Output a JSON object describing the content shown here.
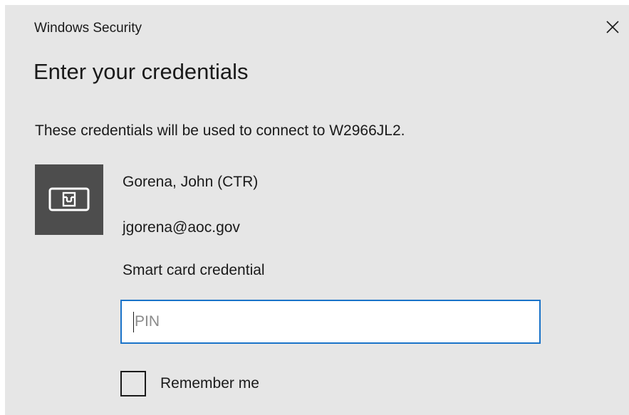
{
  "window": {
    "title": "Windows Security",
    "close_icon": "close-icon"
  },
  "heading": "Enter your credentials",
  "description": "These credentials will be used to connect to W2966JL2.",
  "credential": {
    "icon": "smart-card-icon",
    "name": "Gorena, John (CTR)",
    "email": "jgorena@aoc.gov",
    "type": "Smart card credential"
  },
  "pin": {
    "value": "",
    "placeholder": "PIN"
  },
  "remember": {
    "label": "Remember me",
    "checked": false
  },
  "colors": {
    "dialog_background": "#e6e6e6",
    "tile_background": "#4d4d4d",
    "input_focus_border": "#1a73c9"
  }
}
